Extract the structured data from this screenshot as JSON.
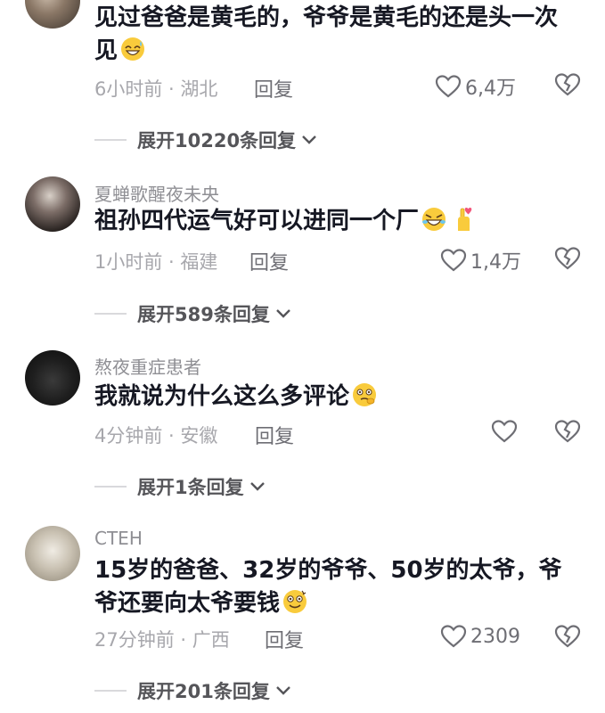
{
  "comments": [
    {
      "username": "",
      "text": "见过爸爸是黄毛的，爷爷是黄毛的还是头一次见",
      "emoji": "grinning-sweat-emoji",
      "meta": "6小时前 · 湖北",
      "reply_label": "回复",
      "likes": "6,4万",
      "expand_label": "展开10220条回复"
    },
    {
      "username": "夏蝉歌醒夜未央",
      "text": "祖孙四代运气好可以进同一个厂",
      "emoji": "rofl-emoji",
      "emoji2": "finger-heart-emoji",
      "meta": "1小时前 · 福建",
      "reply_label": "回复",
      "likes": "1,4万",
      "expand_label": "展开589条回复"
    },
    {
      "username": "熬夜重症患者",
      "text": "我就说为什么这么多评论",
      "emoji": "thinking-emoji",
      "meta": "4分钟前 · 安徽",
      "reply_label": "回复",
      "likes": "",
      "expand_label": "展开1条回复"
    },
    {
      "username": "CTEH",
      "text": "15岁的爸爸、32岁的爷爷、50岁的太爷，爷爷还要向太爷要钱",
      "emoji": "dizzy-smile-emoji",
      "meta": "27分钟前 · 广西",
      "reply_label": "回复",
      "likes": "2309",
      "expand_label": "展开201条回复"
    }
  ],
  "colors": {
    "text": "#161823",
    "secondary": "#8f8f94",
    "emoji_yellow": "#f9cb3c"
  }
}
